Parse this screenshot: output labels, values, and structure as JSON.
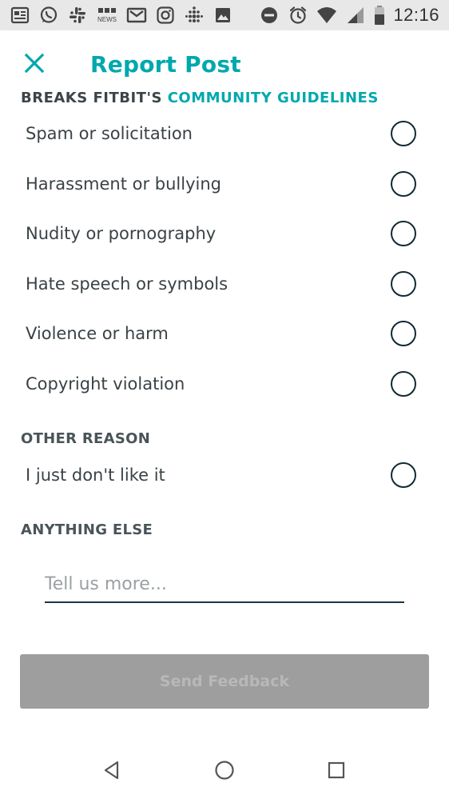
{
  "status_bar": {
    "time": "12:16",
    "left_icons": [
      "news-app-icon",
      "whatsapp-icon",
      "slack-icon",
      "bbc-news-icon",
      "gmail-icon",
      "instagram-icon",
      "fitbit-icon",
      "gallery-icon"
    ],
    "right_icons": [
      "do-not-disturb-icon",
      "alarm-icon",
      "wifi-icon",
      "signal-icon",
      "battery-icon"
    ],
    "bbc_label_top": "BBC",
    "bbc_label_bottom": "NEWS"
  },
  "header": {
    "title": "Report Post",
    "accent_color": "#00a8ae"
  },
  "guidelines_section": {
    "heading_prefix": "BREAKS FITBIT'S ",
    "heading_accent": "COMMUNITY GUIDELINES",
    "options": [
      {
        "label": "Spam or solicitation",
        "selected": false
      },
      {
        "label": "Harassment or bullying",
        "selected": false
      },
      {
        "label": "Nudity or pornography",
        "selected": false
      },
      {
        "label": "Hate speech or symbols",
        "selected": false
      },
      {
        "label": "Violence or harm",
        "selected": false
      },
      {
        "label": "Copyright violation",
        "selected": false
      }
    ]
  },
  "other_section": {
    "heading": "OTHER REASON",
    "options": [
      {
        "label": "I just don't like it",
        "selected": false
      }
    ]
  },
  "anything_else_section": {
    "heading": "ANYTHING ELSE",
    "input_value": "",
    "input_placeholder": "Tell us more..."
  },
  "send_button": {
    "label": "Send Feedback",
    "enabled": false
  },
  "nav_bar": {
    "buttons": [
      "back-icon",
      "home-icon",
      "recents-icon"
    ]
  }
}
